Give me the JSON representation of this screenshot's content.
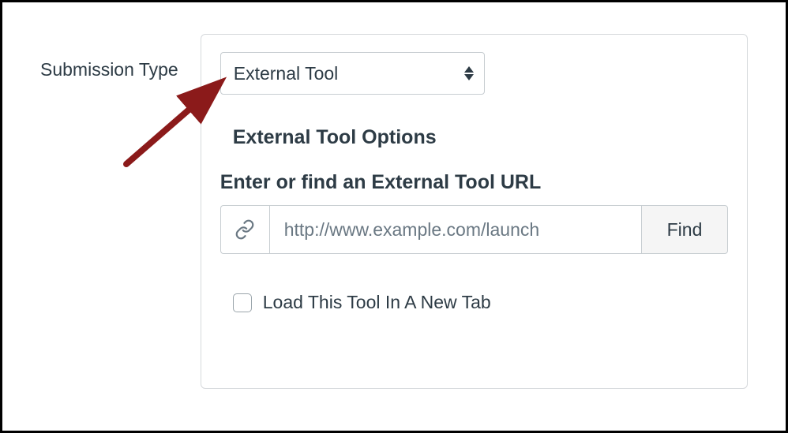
{
  "form": {
    "label": "Submission Type"
  },
  "select": {
    "value": "External Tool"
  },
  "section": {
    "title": "External Tool Options",
    "url_label": "Enter or find an External Tool URL"
  },
  "url_input": {
    "placeholder": "http://www.example.com/launch",
    "value": ""
  },
  "find_button": {
    "label": "Find"
  },
  "checkbox": {
    "label": "Load This Tool In A New Tab",
    "checked": false
  }
}
